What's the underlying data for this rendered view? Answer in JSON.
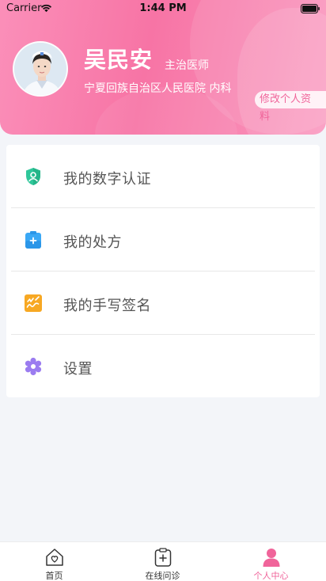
{
  "status_bar": {
    "carrier": "Carrier",
    "time": "1:44 PM"
  },
  "profile": {
    "name": "吴民安",
    "title": "主治医师",
    "hospital": "宁夏回族自治区人民医院 内科",
    "edit_label": "修改个人资料"
  },
  "menu": [
    {
      "label": "我的数字认证",
      "icon": "shield-user-icon"
    },
    {
      "label": "我的处方",
      "icon": "clipboard-plus-icon"
    },
    {
      "label": "我的手写签名",
      "icon": "signature-icon"
    },
    {
      "label": "设置",
      "icon": "gear-icon"
    }
  ],
  "tabs": [
    {
      "label": "首页",
      "icon": "home-heart-icon"
    },
    {
      "label": "在线问诊",
      "icon": "clipboard-plus-icon"
    },
    {
      "label": "个人中心",
      "icon": "person-icon"
    }
  ],
  "colors": {
    "brand_pink": "#f774a5",
    "active_tab": "#f0649a",
    "cert_green": "#2fc79a",
    "prescription_blue": "#3aa8f5",
    "signature_orange": "#f7a823",
    "settings_purple": "#9b7cf0"
  },
  "active_tab": "个人中心"
}
